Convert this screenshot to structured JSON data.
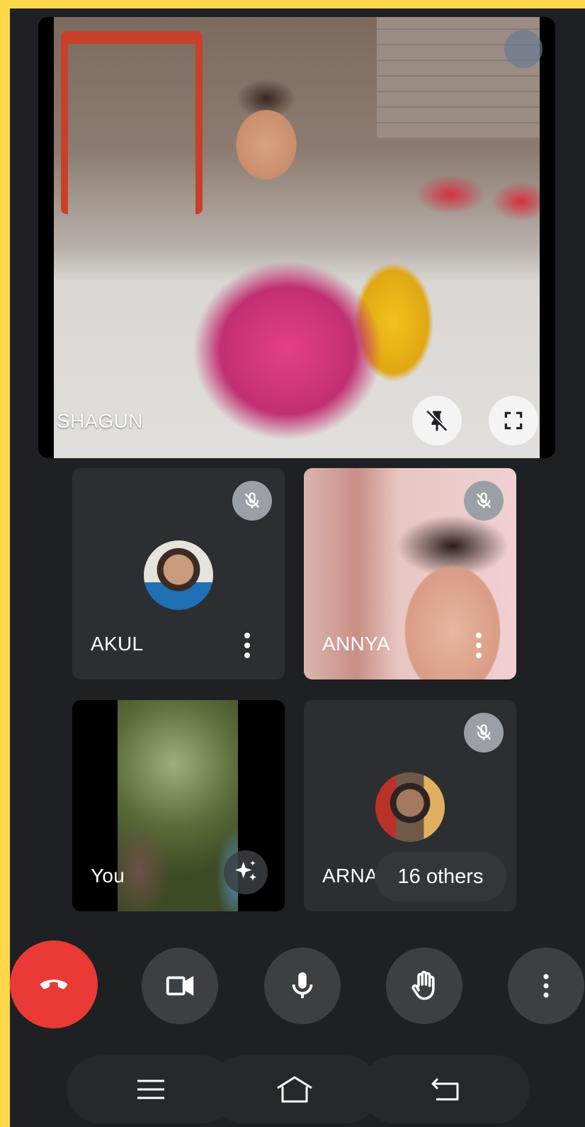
{
  "main": {
    "participant_name": "SHAGUN",
    "unpin_icon": "unpin-icon",
    "fullscreen_icon": "fullscreen-icon"
  },
  "tiles": [
    {
      "name": "AKUL",
      "muted": true,
      "video": false
    },
    {
      "name": "ANNYA",
      "muted": true,
      "video": true
    },
    {
      "name": "You",
      "muted": false,
      "video": true
    },
    {
      "name": "ARNAV",
      "muted": true,
      "video": false
    }
  ],
  "others_chip": "16 others",
  "controls": {
    "hangup_icon": "hang-up-icon",
    "camera_icon": "video-camera-icon",
    "mic_icon": "microphone-icon",
    "hand_icon": "raise-hand-icon",
    "more_icon": "more-vert-icon",
    "hangup_color": "#ea3a35"
  },
  "navbar": {
    "menu_icon": "menu-icon",
    "home_icon": "home-icon",
    "back_icon": "back-icon"
  }
}
